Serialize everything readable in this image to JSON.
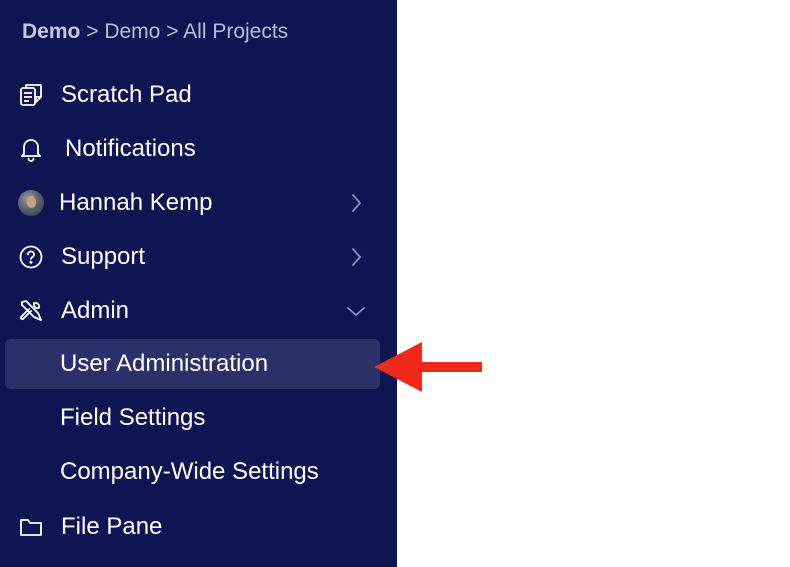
{
  "breadcrumb": {
    "root": "Demo",
    "separator": ">",
    "middle": "Demo",
    "current": "All Projects"
  },
  "nav": {
    "scratch_pad": "Scratch Pad",
    "notifications": "Notifications",
    "user": "Hannah Kemp",
    "support": "Support",
    "admin": "Admin",
    "admin_items": {
      "user_administration": "User Administration",
      "field_settings": "Field Settings",
      "company_wide_settings": "Company-Wide Settings"
    },
    "file_pane": "File Pane"
  },
  "icons": {
    "scratch_pad": "scratch-pad-icon",
    "notifications": "bell-icon",
    "user": "avatar",
    "support": "question-circle-icon",
    "admin": "tools-icon",
    "file_pane": "folder-icon",
    "expand": "chevron-right-icon",
    "collapse": "chevron-down-icon",
    "pointer": "red-arrow-annotation"
  },
  "colors": {
    "sidebar_bg": "#0f1452",
    "active_bg": "#2c3068",
    "text": "#ffffff",
    "breadcrumb_text": "#b8bcd8",
    "arrow": "#f0291b"
  }
}
